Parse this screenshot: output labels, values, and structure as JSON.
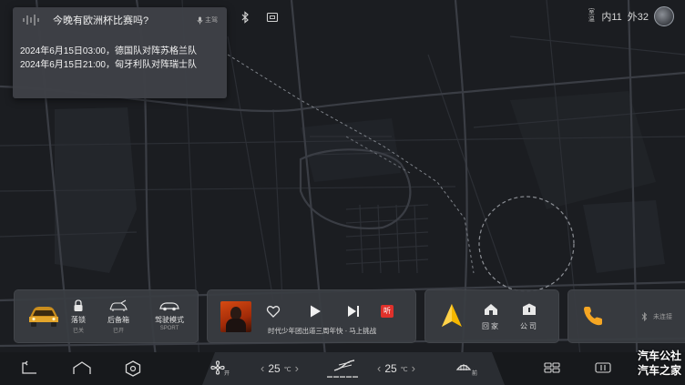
{
  "status_bar": {
    "bluetooth_icon": "bluetooth-icon",
    "screen_icon": "screen-icon",
    "temp_label_top": "室",
    "temp_label_bottom": "温",
    "inside_temp": "内11",
    "outside_temp": "外32"
  },
  "voice_assistant": {
    "question": "今晚有欧洲杯比赛吗?",
    "seat_label": "主驾",
    "answer_lines": [
      "2024年6月15日03:00，德国队对阵苏格兰队",
      "2024年6月15日21:00，匈牙利队对阵瑞士队"
    ]
  },
  "vehicle_card": {
    "lock": {
      "label": "落锁",
      "status": "已关"
    },
    "trunk": {
      "label": "后备箱",
      "status": "已开"
    },
    "drive_mode": {
      "label": "驾驶模式",
      "status": "SPORT"
    }
  },
  "media_card": {
    "track_title": "时代少年团出道三周年快",
    "track_separator": " - ",
    "track_source": "马上挑战",
    "listen_badge": "听"
  },
  "nav_card": {
    "home_label": "回家",
    "company_label": "公司"
  },
  "phone_card": {
    "bt_status": "未连接"
  },
  "dock": {
    "fan_label": "开",
    "left_temp": "25",
    "right_temp": "25",
    "temp_unit": "℃",
    "defrost_label": "前",
    "seat_dots": "▬▬▬▬▬"
  },
  "watermark": {
    "line1": "汽车公社",
    "line2": "汽车之家"
  },
  "colors": {
    "accent_nav": "#f5b700",
    "accent_phone": "#f5a623",
    "listen_red": "#e0312b"
  }
}
